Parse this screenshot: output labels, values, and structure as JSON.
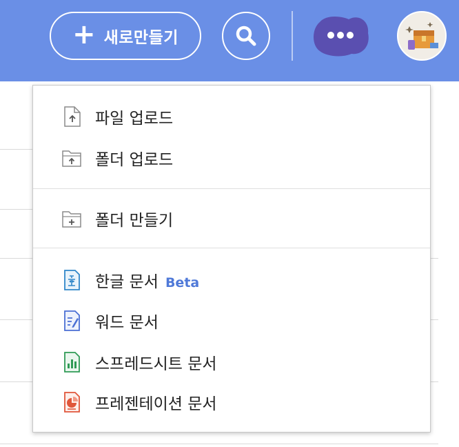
{
  "topbar": {
    "new_button_label": "새로만들기",
    "icons": {
      "new": "plus-icon",
      "search": "search-icon",
      "more": "more-dots-icon",
      "avatar": "treasure-chest-avatar-icon"
    },
    "colors": {
      "bar": "#6a8fe6",
      "more_button": "#5a4fb0"
    }
  },
  "menu": {
    "upload_group": [
      {
        "label": "파일 업로드",
        "icon": "file-upload-icon"
      },
      {
        "label": "폴더 업로드",
        "icon": "folder-upload-icon"
      }
    ],
    "create_folder": {
      "label": "폴더 만들기",
      "icon": "folder-add-icon"
    },
    "documents": [
      {
        "label": "한글 문서",
        "badge": "Beta",
        "icon": "hangul-doc-icon",
        "color": "#2f86c9"
      },
      {
        "label": "워드 문서",
        "icon": "word-doc-icon",
        "color": "#4a6fd4"
      },
      {
        "label": "스프레드시트 문서",
        "icon": "spreadsheet-doc-icon",
        "color": "#2f9a55"
      },
      {
        "label": "프레젠테이션 문서",
        "icon": "presentation-doc-icon",
        "color": "#e0563a"
      }
    ],
    "beta_color": "#4f79d8"
  }
}
